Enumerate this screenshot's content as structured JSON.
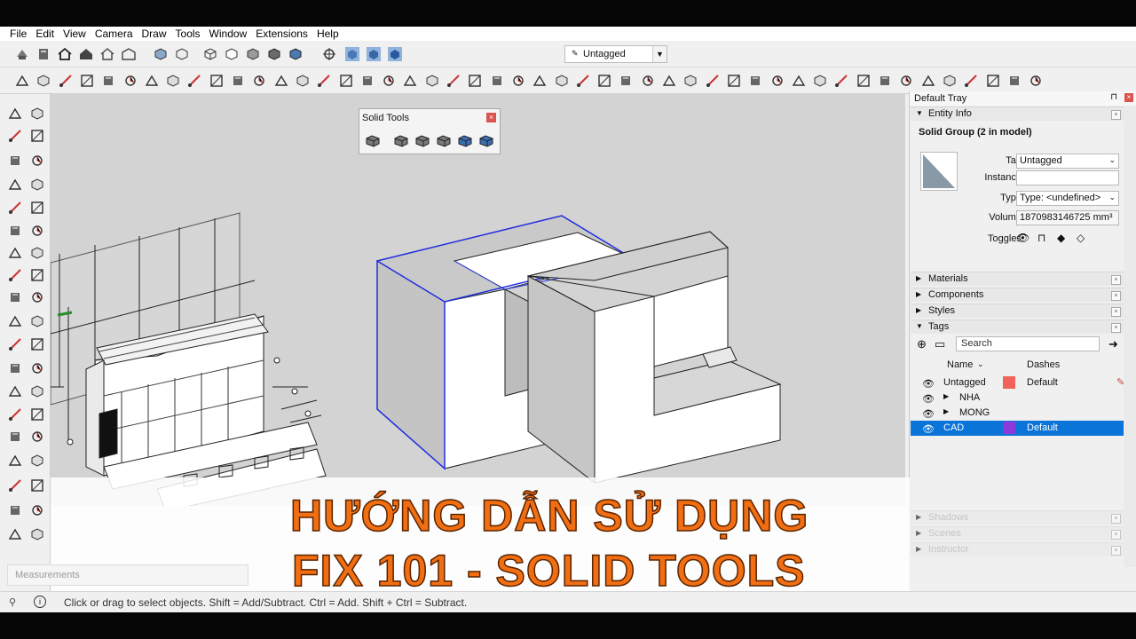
{
  "menu": [
    "File",
    "Edit",
    "View",
    "Camera",
    "Draw",
    "Tools",
    "Window",
    "Extensions",
    "Help"
  ],
  "tag_selector": {
    "value": "Untagged"
  },
  "solid_tools": {
    "title": "Solid Tools",
    "close": "×"
  },
  "tray": {
    "title": "Default Tray",
    "pin": "⊓",
    "close": "×",
    "entity_info": {
      "title": "Entity Info",
      "name": "Solid Group (2 in model)",
      "tag_label": "Tag:",
      "tag_value": "Untagged",
      "instance_label": "Instance:",
      "instance_value": "",
      "type_label": "Type:",
      "type_value": "Type: <undefined>",
      "volume_label": "Volume:",
      "volume_value": "1870983146725 mm³",
      "toggles_label": "Toggles:"
    },
    "sections": [
      "Materials",
      "Components",
      "Styles",
      "Tags"
    ],
    "tags": {
      "search_placeholder": "Search",
      "col_name": "Name",
      "col_dashes": "Dashes",
      "rows": [
        {
          "name": "Untagged",
          "color": "#f0625a",
          "dashes": "Default"
        },
        {
          "name": "NHA",
          "color": "",
          "dashes": ""
        },
        {
          "name": "MONG",
          "color": "",
          "dashes": ""
        },
        {
          "name": "CAD",
          "color": "#8c3ad9",
          "dashes": "Default"
        }
      ]
    },
    "dim_sections": [
      "Shadows",
      "Scenes",
      "Instructor"
    ]
  },
  "caption": {
    "line1": "HƯỚNG DẪN SỬ DỤNG",
    "line2": "FIX 101 - SOLID TOOLS"
  },
  "measurements_label": "Measurements",
  "status_message": "Click or drag to select objects. Shift = Add/Subtract. Ctrl = Add. Shift + Ctrl = Subtract."
}
